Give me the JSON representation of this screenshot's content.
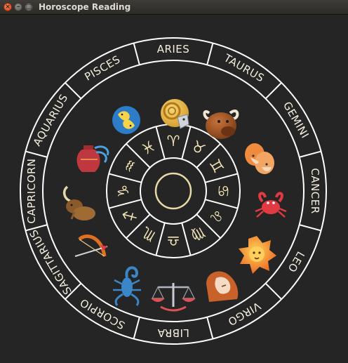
{
  "window": {
    "title": "Horoscope Reading"
  },
  "theme": {
    "background": "#252525",
    "ring_line": "#ffffff",
    "glyph_color": "#f1e3b6",
    "label_color": "#f4efdf"
  },
  "signs": [
    {
      "name": "ARIES",
      "glyph": "♈",
      "icon": "ram-icon"
    },
    {
      "name": "TAURUS",
      "glyph": "♉",
      "icon": "bull-icon"
    },
    {
      "name": "GEMINI",
      "glyph": "♊",
      "icon": "twins-icon"
    },
    {
      "name": "CANCER",
      "glyph": "♋",
      "icon": "crab-icon"
    },
    {
      "name": "LEO",
      "glyph": "♌",
      "icon": "lion-icon"
    },
    {
      "name": "VIRGO",
      "glyph": "♍",
      "icon": "maiden-icon"
    },
    {
      "name": "LIBRA",
      "glyph": "♎",
      "icon": "scales-icon"
    },
    {
      "name": "SCORPIO",
      "glyph": "♏",
      "icon": "scorpion-icon"
    },
    {
      "name": "SAGITTARIUS",
      "glyph": "♐",
      "icon": "bow-arrow-icon"
    },
    {
      "name": "CAPRICORN",
      "glyph": "♑",
      "icon": "goat-icon"
    },
    {
      "name": "AQUARIUS",
      "glyph": "♒",
      "icon": "water-jug-icon"
    },
    {
      "name": "PISCES",
      "glyph": "♓",
      "icon": "fish-icon"
    }
  ]
}
